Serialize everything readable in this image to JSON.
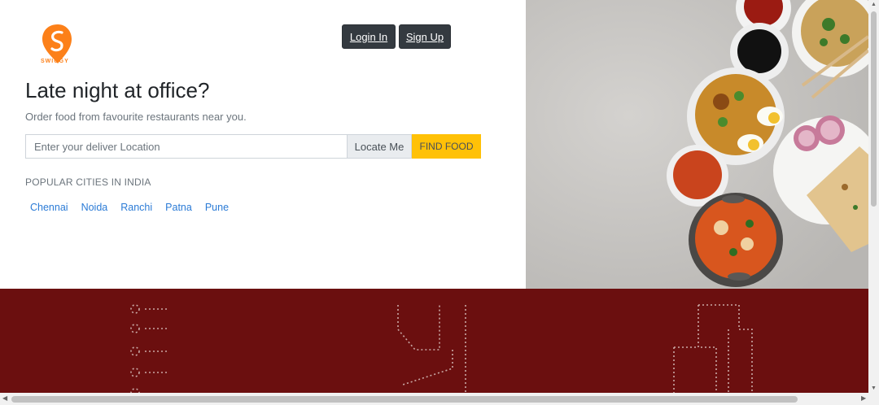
{
  "brand": {
    "name": "SWIGGY",
    "color": "#fc8019"
  },
  "header": {
    "login_label": "Login In",
    "signup_label": "Sign Up"
  },
  "hero": {
    "title": "Late night at office?",
    "subtitle": "Order food from favourite restaurants near you.",
    "search": {
      "placeholder": "Enter your deliver Location",
      "value": "",
      "locate_label": "Locate Me",
      "find_label": "FIND FOOD"
    },
    "popular_title": "POPULAR CITIES IN INDIA",
    "cities": [
      "Chennai",
      "Noida",
      "Ranchi",
      "Patna",
      "Pune"
    ]
  },
  "colors": {
    "band": "#6b0f0f",
    "accent": "#ffc107",
    "dark_button": "#343a40",
    "link": "#2b7bd6"
  },
  "icons": [
    "swiggy-logo-icon",
    "food-bowls-image",
    "dotted-line-art"
  ]
}
